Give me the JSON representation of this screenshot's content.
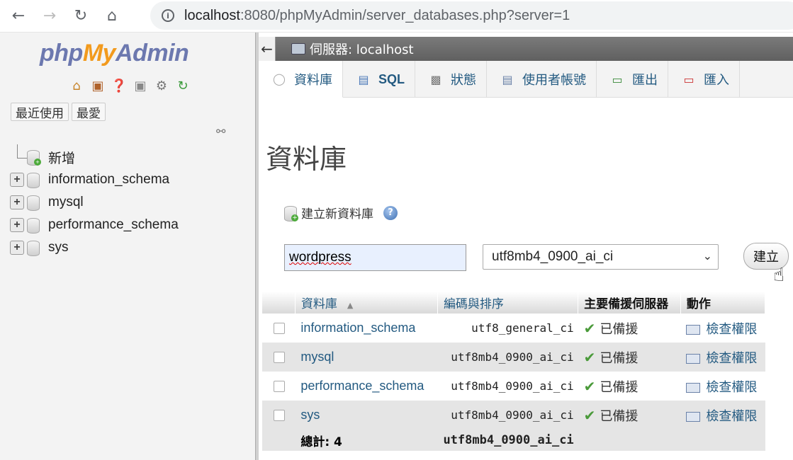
{
  "browser": {
    "url_host": "localhost",
    "url_rest": ":8080/phpMyAdmin/server_databases.php?server=1"
  },
  "sidebar": {
    "logo": {
      "php": "php",
      "my": "My",
      "admin": "Admin"
    },
    "logo_icons": [
      "home-icon",
      "logout-icon",
      "help-icon",
      "docs-icon",
      "settings-icon",
      "reload-icon"
    ],
    "recent_label": "最近使用",
    "favorites_label": "最愛",
    "tree": [
      {
        "label": "新增",
        "type": "new"
      },
      {
        "label": "information_schema",
        "type": "db"
      },
      {
        "label": "mysql",
        "type": "db"
      },
      {
        "label": "performance_schema",
        "type": "db"
      },
      {
        "label": "sys",
        "type": "db"
      }
    ]
  },
  "header": {
    "server_label": "伺服器: localhost"
  },
  "tabs": [
    {
      "label": "資料庫",
      "icon": "database-icon",
      "active": true
    },
    {
      "label": "SQL",
      "icon": "sql-icon",
      "active": false
    },
    {
      "label": "狀態",
      "icon": "status-icon",
      "active": false
    },
    {
      "label": "使用者帳號",
      "icon": "users-icon",
      "active": false
    },
    {
      "label": "匯出",
      "icon": "export-icon",
      "active": false
    },
    {
      "label": "匯入",
      "icon": "import-icon",
      "active": false
    }
  ],
  "main": {
    "title": "資料庫",
    "create_heading": "建立新資料庫",
    "db_name_value": "wordpress",
    "collation_value": "utf8mb4_0900_ai_ci",
    "create_button": "建立"
  },
  "table": {
    "headers": {
      "name": "資料庫",
      "collation": "編碼與排序",
      "replication": "主要備援伺服器",
      "action": "動作"
    },
    "rows": [
      {
        "name": "information_schema",
        "collation": "utf8_general_ci",
        "replication": "已備援",
        "action": "檢查權限"
      },
      {
        "name": "mysql",
        "collation": "utf8mb4_0900_ai_ci",
        "replication": "已備援",
        "action": "檢查權限"
      },
      {
        "name": "performance_schema",
        "collation": "utf8mb4_0900_ai_ci",
        "replication": "已備援",
        "action": "檢查權限"
      },
      {
        "name": "sys",
        "collation": "utf8mb4_0900_ai_ci",
        "replication": "已備援",
        "action": "檢查權限"
      }
    ],
    "total_label": "總計: 4",
    "total_collation": "utf8mb4_0900_ai_ci"
  }
}
